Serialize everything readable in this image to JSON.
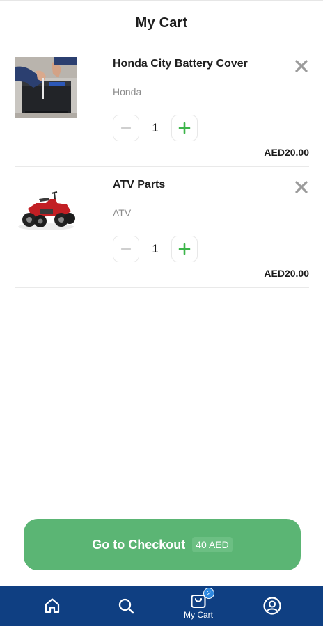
{
  "header": {
    "title": "My Cart"
  },
  "items": [
    {
      "name": "Honda City Battery Cover",
      "brand": "Honda",
      "quantity": "1",
      "price": "AED20.00",
      "image_icon": "car-battery-photo"
    },
    {
      "name": "ATV Parts",
      "brand": "ATV",
      "quantity": "1",
      "price": "AED20.00",
      "image_icon": "atv-photo"
    }
  ],
  "checkout": {
    "label": "Go to Checkout",
    "total": "40 AED"
  },
  "nav": {
    "home_icon": "home-icon",
    "search_icon": "search-icon",
    "cart_label": "My Cart",
    "cart_badge": "2",
    "profile_icon": "user-circle-icon"
  },
  "colors": {
    "accent_green": "#5bb574",
    "plus_green": "#3cb54a",
    "nav_blue": "#0f3f82",
    "badge_blue": "#2f89e0"
  }
}
